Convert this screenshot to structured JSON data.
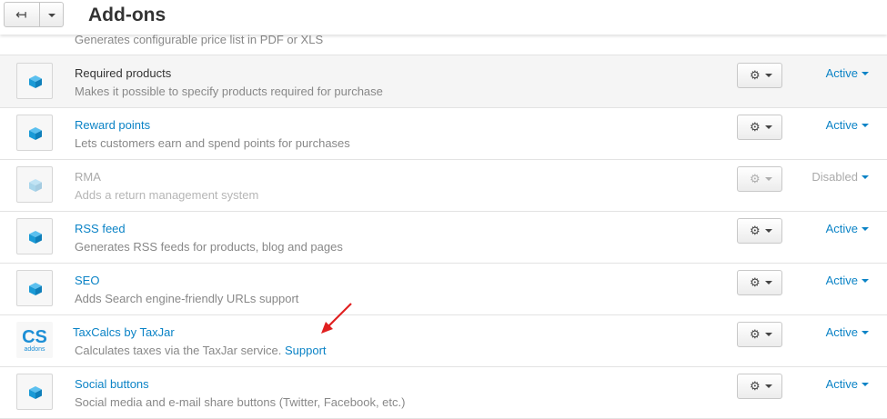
{
  "header": {
    "title": "Add-ons",
    "back_icon": "↤"
  },
  "partial_row": {
    "description": "Generates configurable price list in PDF or XLS"
  },
  "addons": [
    {
      "title": "Required products",
      "description": "Makes it possible to specify products required for purchase",
      "status": "Active"
    },
    {
      "title": "Reward points",
      "description": "Lets customers earn and spend points for purchases",
      "status": "Active"
    },
    {
      "title": "RMA",
      "description": "Adds a return management system",
      "status": "Disabled"
    },
    {
      "title": "RSS feed",
      "description": "Generates RSS feeds for products, blog and pages",
      "status": "Active"
    },
    {
      "title": "SEO",
      "description": "Adds Search engine-friendly URLs support",
      "status": "Active"
    },
    {
      "title": "TaxCalcs by TaxJar",
      "description": "Calculates taxes via the TaxJar service.",
      "link": "Support",
      "status": "Active",
      "logo_big": "CS",
      "logo_small": "addons"
    },
    {
      "title": "Social buttons",
      "description": "Social media and e-mail share buttons (Twitter, Facebook, etc.)",
      "status": "Active"
    }
  ],
  "icons": {
    "gear": "⚙",
    "addon": "cube-icon"
  },
  "colors": {
    "link": "#0b83c6",
    "cube": "#1a9ad6",
    "annotation_arrow": "#e02020"
  }
}
